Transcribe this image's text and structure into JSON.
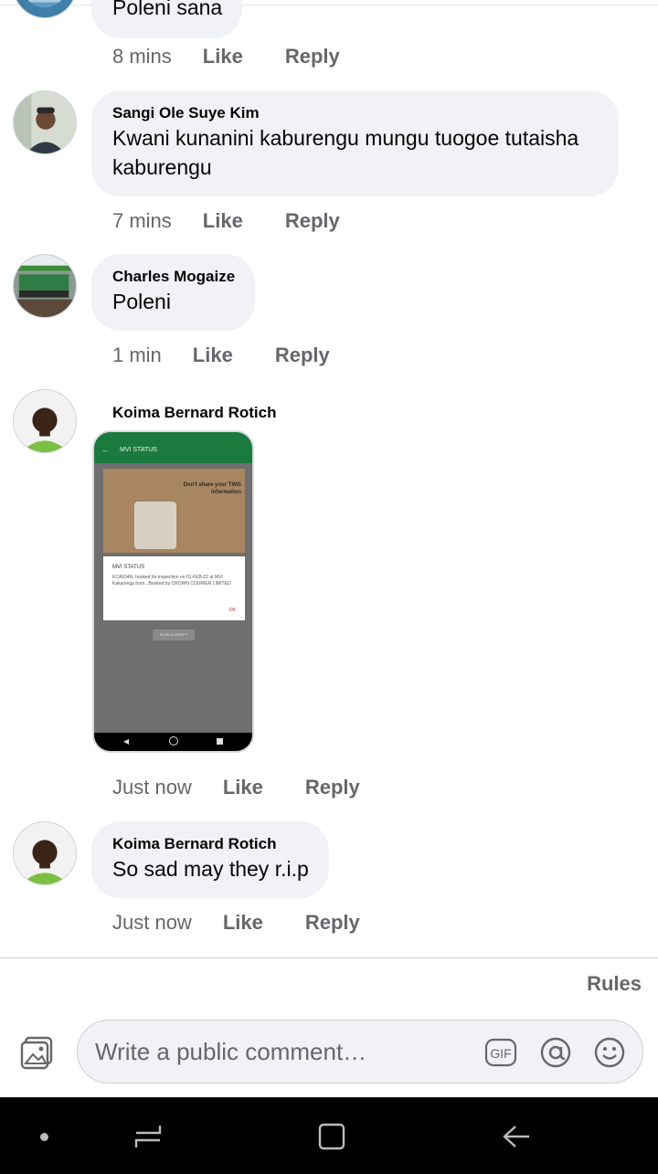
{
  "comments": [
    {
      "author": "",
      "text": "Poleni sana",
      "time": "8 mins",
      "like": "Like",
      "reply": "Reply"
    },
    {
      "author": "Sangi Ole Suye Kim",
      "text": "Kwani kunanini kaburengu mungu tuogoe tutaisha kaburengu",
      "time": "7 mins",
      "like": "Like",
      "reply": "Reply"
    },
    {
      "author": "Charles Mogaize",
      "text": "Poleni",
      "time": "1 min",
      "like": "Like",
      "reply": "Reply"
    },
    {
      "author": "Koima Bernard Rotich",
      "attachment": {
        "app_title": "MVI STATUS",
        "banner": "Don't share your TIMS information",
        "dialog_title": "MVI STATUS",
        "dialog_text": "KCA934N, booked for inspection on:01-FEB-22 at MVI Kakamega from...Booked by:CROWN COURIER LIMITED",
        "dialog_ok": "OK",
        "scan_button": "SCAN & VERIFY"
      },
      "time": "Just now",
      "like": "Like",
      "reply": "Reply"
    },
    {
      "author": "Koima Bernard Rotich",
      "text": "So sad may they r.i.p",
      "time": "Just now",
      "like": "Like",
      "reply": "Reply"
    }
  ],
  "footer": {
    "rules": "Rules"
  },
  "composer": {
    "placeholder": "Write a public comment…",
    "gif_label": "GIF"
  },
  "colors": {
    "bubble": "#f0f2f5",
    "meta_text": "#65676b",
    "app_green": "#1b7a3e",
    "nav_bar": "#000000"
  },
  "icons": [
    "photo-icon",
    "gif-icon",
    "mention-icon",
    "emoji-icon",
    "recent-apps-icon",
    "home-icon",
    "back-icon"
  ]
}
